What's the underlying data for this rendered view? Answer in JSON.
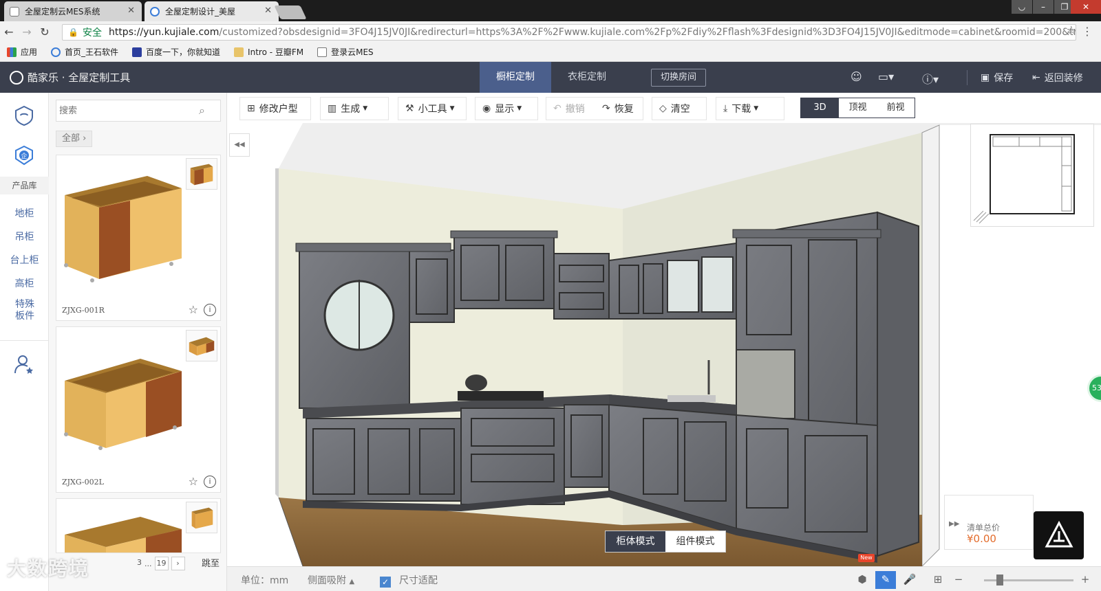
{
  "browser": {
    "tabs": [
      {
        "title": "全屋定制云MES系统",
        "active": false
      },
      {
        "title": "全屋定制设计_美屋",
        "active": true
      }
    ],
    "security_label": "安全",
    "url_host": "https://yun.kujiale.com",
    "url_rest": "/customized?obsdesignid=3FO4J15JV0JI&redirecturl=https%3A%2F%2Fwww.kujiale.com%2Fp%2Fdiy%2Fflash%3Fdesignid%3D3FO4J15JV0JI&editmode=cabinet&roomid=200&tr...",
    "bookmarks": [
      "应用",
      "首页_王石软件",
      "百度一下，你就知道",
      "Intro - 豆瓣FM",
      "登录云MES"
    ]
  },
  "app": {
    "logo_text": "酷家乐 · 全屋定制工具",
    "tabs": [
      {
        "label": "橱柜定制",
        "active": true
      },
      {
        "label": "衣柜定制",
        "active": false
      }
    ],
    "switch_room": "切换房间",
    "save": "保存",
    "back": "返回装修"
  },
  "rail": {
    "product_lib": "产品库",
    "categories": [
      "地柜",
      "吊柜",
      "台上柜",
      "高柜",
      "特殊板件"
    ]
  },
  "panel": {
    "search_placeholder": "搜索",
    "crumb": "全部",
    "products": [
      {
        "code": "ZJXG-001R"
      },
      {
        "code": "ZJXG-002L"
      },
      {
        "code": ""
      }
    ],
    "pager": {
      "pages": [
        "3",
        "...",
        "19"
      ],
      "jump": "跳至"
    }
  },
  "toolbar": {
    "edit_floor": "修改户型",
    "generate": "生成",
    "tools": "小工具",
    "display": "显示",
    "undo": "撤销",
    "redo": "恢复",
    "clear": "清空",
    "download": "下载",
    "views": [
      "3D",
      "顶视",
      "前视"
    ],
    "active_view": "3D"
  },
  "canvas": {
    "modes": [
      "柜体模式",
      "组件模式"
    ],
    "active_mode": "柜体模式",
    "price_label": "清单总价",
    "price_value": "¥0.00",
    "chat_badge": "53"
  },
  "statusbar": {
    "unit": "单位：mm",
    "side_snap": "侧面吸附",
    "fit": "尺寸适配",
    "new_tag": "New"
  },
  "watermark": "大数跨境",
  "colors": {
    "header_bg": "#3a3f4d",
    "active_tab": "#4b5f8c",
    "accent_blue": "#3b7dd8",
    "price": "#e36c2c",
    "cabinet": "#6b6d72",
    "floor": "#8a6a3e"
  }
}
